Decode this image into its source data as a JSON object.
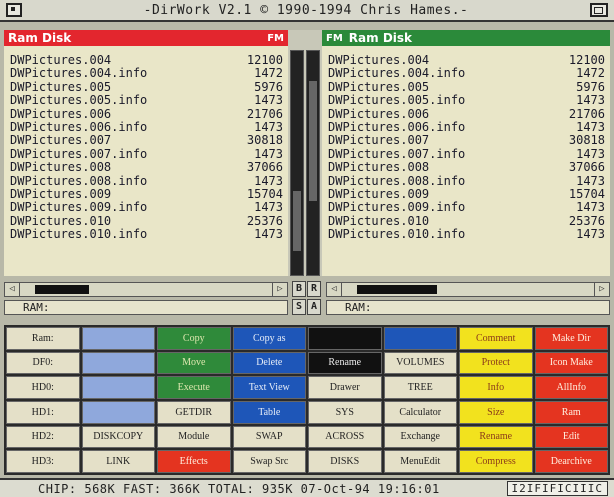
{
  "window": {
    "title": "-DirWork V2.1 © 1990-1994 Chris Hames.-"
  },
  "left_panel": {
    "header": "Ram Disk",
    "header_tag": "FM",
    "files": [
      {
        "name": "DWPictures.004",
        "size": "12100"
      },
      {
        "name": "DWPictures.004.info",
        "size": "1472"
      },
      {
        "name": "DWPictures.005",
        "size": "5976"
      },
      {
        "name": "DWPictures.005.info",
        "size": "1473"
      },
      {
        "name": "DWPictures.006",
        "size": "21706"
      },
      {
        "name": "DWPictures.006.info",
        "size": "1473"
      },
      {
        "name": "DWPictures.007",
        "size": "30818"
      },
      {
        "name": "DWPictures.007.info",
        "size": "1473"
      },
      {
        "name": "DWPictures.008",
        "size": "37066"
      },
      {
        "name": "DWPictures.008.info",
        "size": "1473"
      },
      {
        "name": "DWPictures.009",
        "size": "15704"
      },
      {
        "name": "DWPictures.009.info",
        "size": "1473"
      },
      {
        "name": "DWPictures.010",
        "size": "25376"
      },
      {
        "name": "DWPictures.010.info",
        "size": "1473"
      }
    ],
    "path": "RAM:"
  },
  "right_panel": {
    "header": "Ram Disk",
    "header_tag": "FM",
    "files": [
      {
        "name": "DWPictures.004",
        "size": "12100"
      },
      {
        "name": "DWPictures.004.info",
        "size": "1472"
      },
      {
        "name": "DWPictures.005",
        "size": "5976"
      },
      {
        "name": "DWPictures.005.info",
        "size": "1473"
      },
      {
        "name": "DWPictures.006",
        "size": "21706"
      },
      {
        "name": "DWPictures.006.info",
        "size": "1473"
      },
      {
        "name": "DWPictures.007",
        "size": "30818"
      },
      {
        "name": "DWPictures.007.info",
        "size": "1473"
      },
      {
        "name": "DWPictures.008",
        "size": "37066"
      },
      {
        "name": "DWPictures.008.info",
        "size": "1473"
      },
      {
        "name": "DWPictures.009",
        "size": "15704"
      },
      {
        "name": "DWPictures.009.info",
        "size": "1473"
      },
      {
        "name": "DWPictures.010",
        "size": "25376"
      },
      {
        "name": "DWPictures.010.info",
        "size": "1473"
      }
    ],
    "path": "RAM:"
  },
  "mid_buttons": {
    "b1": "B",
    "b2": "R",
    "s": "S",
    "a": "A"
  },
  "buttons": [
    [
      {
        "label": "Ram:",
        "color": "light"
      },
      {
        "label": "",
        "color": "lblue"
      },
      {
        "label": "Copy",
        "color": "green"
      },
      {
        "label": "Copy as",
        "color": "blue"
      },
      {
        "label": "",
        "color": "black"
      },
      {
        "label": "",
        "color": "blue"
      },
      {
        "label": "Comment",
        "color": "yellow"
      },
      {
        "label": "Make Dir",
        "color": "red"
      }
    ],
    [
      {
        "label": "DF0:",
        "color": "light"
      },
      {
        "label": "",
        "color": "lblue"
      },
      {
        "label": "Move",
        "color": "green"
      },
      {
        "label": "Delete",
        "color": "blue"
      },
      {
        "label": "Rename",
        "color": "black"
      },
      {
        "label": "VOLUMES",
        "color": "light"
      },
      {
        "label": "Protect",
        "color": "yellow"
      },
      {
        "label": "Icon Make",
        "color": "red"
      }
    ],
    [
      {
        "label": "HD0:",
        "color": "light"
      },
      {
        "label": "",
        "color": "lblue"
      },
      {
        "label": "Execute",
        "color": "green"
      },
      {
        "label": "Text View",
        "color": "blue"
      },
      {
        "label": "Drawer",
        "color": "light"
      },
      {
        "label": "TREE",
        "color": "light"
      },
      {
        "label": "Info",
        "color": "yellow"
      },
      {
        "label": "AllInfo",
        "color": "red"
      }
    ],
    [
      {
        "label": "HD1:",
        "color": "light"
      },
      {
        "label": "",
        "color": "lblue"
      },
      {
        "label": "GETDIR",
        "color": "light"
      },
      {
        "label": "Table",
        "color": "blue"
      },
      {
        "label": "SYS",
        "color": "light"
      },
      {
        "label": "Calculator",
        "color": "light"
      },
      {
        "label": "Size",
        "color": "yellow"
      },
      {
        "label": "Ram",
        "color": "red"
      }
    ],
    [
      {
        "label": "HD2:",
        "color": "light"
      },
      {
        "label": "DISKCOPY",
        "color": "light"
      },
      {
        "label": "Module",
        "color": "light"
      },
      {
        "label": "SWAP",
        "color": "light"
      },
      {
        "label": "ACROSS",
        "color": "light"
      },
      {
        "label": "Exchange",
        "color": "light"
      },
      {
        "label": "Rename",
        "color": "yellow"
      },
      {
        "label": "Edit",
        "color": "red"
      }
    ],
    [
      {
        "label": "HD3:",
        "color": "light"
      },
      {
        "label": "LINK",
        "color": "light"
      },
      {
        "label": "Effects",
        "color": "red"
      },
      {
        "label": "Swap Src",
        "color": "light"
      },
      {
        "label": "DISKS",
        "color": "light"
      },
      {
        "label": "MenuEdit",
        "color": "light"
      },
      {
        "label": "Compress",
        "color": "yellow"
      },
      {
        "label": "Dearchive",
        "color": "red"
      }
    ]
  ],
  "status": {
    "text": "CHIP: 568K  FAST: 366K  TOTAL: 935K  07-Oct-94  19:16:01",
    "field": "I2IFIFICIIIC"
  }
}
